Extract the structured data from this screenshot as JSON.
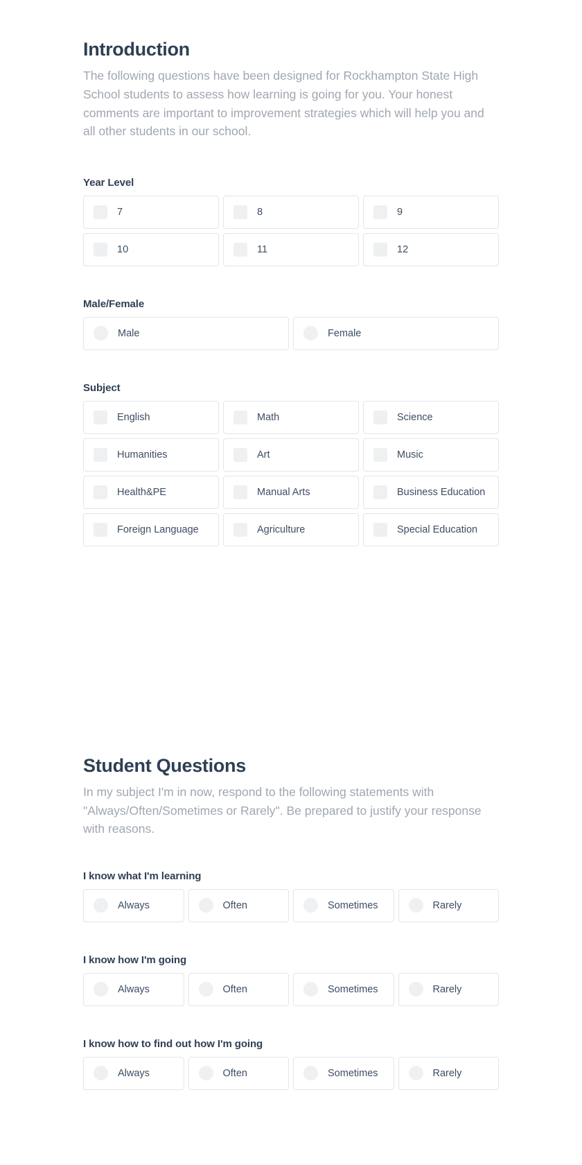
{
  "intro": {
    "heading": "Introduction",
    "description": "The following questions have been designed for Rockhampton State High School students to assess how learning is going for you. Your honest comments are important to improvement strategies which will help you and all other students in our school."
  },
  "fields": {
    "year_level": {
      "label": "Year Level",
      "type": "checkbox",
      "columns": 3,
      "options": [
        "7",
        "8",
        "9",
        "10",
        "11",
        "12"
      ]
    },
    "gender": {
      "label": "Male/Female",
      "type": "radio",
      "columns": 2,
      "options": [
        "Male",
        "Female"
      ]
    },
    "subject": {
      "label": "Subject",
      "type": "checkbox",
      "columns": 3,
      "options": [
        "English",
        "Math",
        "Science",
        "Humanities",
        "Art",
        "Music",
        "Health&PE",
        "Manual Arts",
        "Business Education",
        "Foreign Language",
        "Agriculture",
        "Special Education"
      ]
    }
  },
  "questions_section": {
    "heading": "Student Questions",
    "description": "In my subject I'm in now, respond to the following statements with \"Always/Often/Sometimes or Rarely\". Be prepared to justify your response with reasons.",
    "scale": [
      "Always",
      "Often",
      "Sometimes",
      "Rarely"
    ],
    "questions": [
      {
        "label": "I know what I'm learning"
      },
      {
        "label": "I know how I'm going"
      },
      {
        "label": "I know how to find out how I'm going"
      }
    ]
  },
  "colors": {
    "heading": "#2e3f54",
    "body_text": "#a0a7b0",
    "option_text": "#3d4d63",
    "border": "#e3e5e8",
    "control_fill": "#eef0f2",
    "background": "#ffffff"
  }
}
